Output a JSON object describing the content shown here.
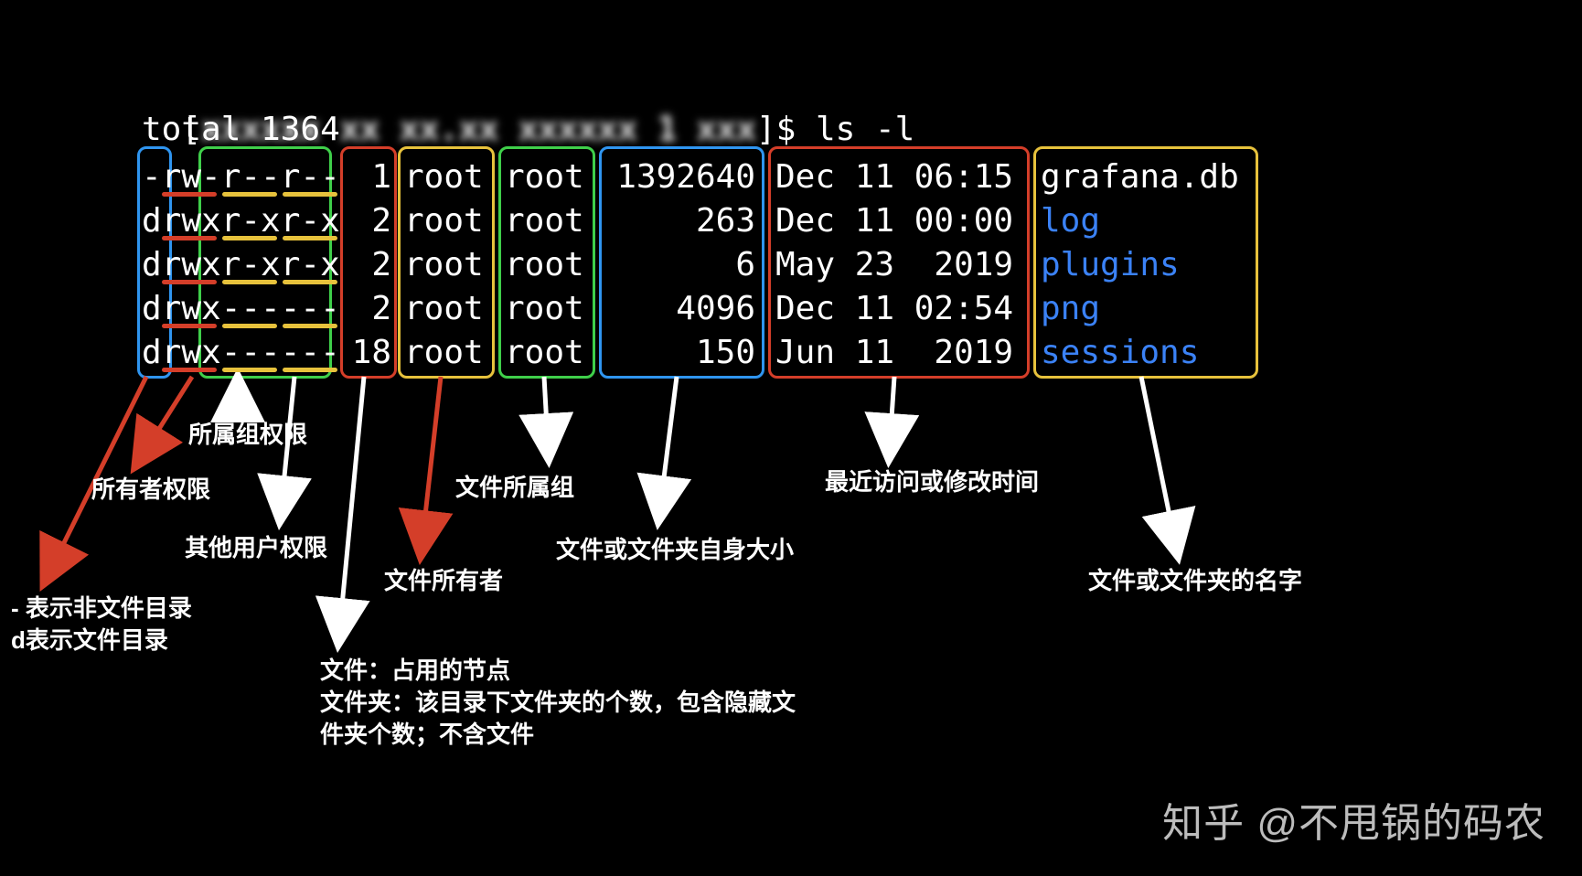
{
  "terminal": {
    "prompt_left": "[",
    "prompt_blur": "xxxxxx xx xx.xx xxxxxx 1 xxx",
    "prompt_right": "]$ ",
    "command": "ls -l",
    "total_line": "total 1364",
    "rows": [
      {
        "perms": "-rw-r--r--",
        "links": "1",
        "owner": "root",
        "group": "root",
        "size": "1392640",
        "date": "Dec 11 06:15",
        "name": "grafana.db",
        "is_dir": false
      },
      {
        "perms": "drwxr-xr-x",
        "links": "2",
        "owner": "root",
        "group": "root",
        "size": "263",
        "date": "Dec 11 00:00",
        "name": "log",
        "is_dir": true
      },
      {
        "perms": "drwxr-xr-x",
        "links": "2",
        "owner": "root",
        "group": "root",
        "size": "6",
        "date": "May 23  2019",
        "name": "plugins",
        "is_dir": true
      },
      {
        "perms": "drwx------",
        "links": "2",
        "owner": "root",
        "group": "root",
        "size": "4096",
        "date": "Dec 11 02:54",
        "name": "png",
        "is_dir": true
      },
      {
        "perms": "drwx------",
        "links": "18",
        "owner": "root",
        "group": "root",
        "size": "150",
        "date": "Jun 11  2019",
        "name": "sessions",
        "is_dir": true
      }
    ]
  },
  "labels": {
    "type_line1": "- 表示非文件目录",
    "type_line2": "d表示文件目录",
    "owner_perm": "所有者权限",
    "group_perm": "所属组权限",
    "other_perm": "其他用户权限",
    "links_line1": "文件：占用的节点",
    "links_line2": "文件夹：该目录下文件夹的个数，包含隐藏文",
    "links_line3": "件夹个数；不含文件",
    "file_owner": "文件所有者",
    "file_group": "文件所属组",
    "file_size": "文件或文件夹自身大小",
    "file_time": "最近访问或修改时间",
    "file_name": "文件或文件夹的名字"
  },
  "watermark": "知乎 @不甩锅的码农",
  "colors": {
    "blue": "#2f95f0",
    "green": "#3fcf4a",
    "yellow": "#e7c23c",
    "red": "#d43e29",
    "dir_text": "#3b82f6"
  }
}
